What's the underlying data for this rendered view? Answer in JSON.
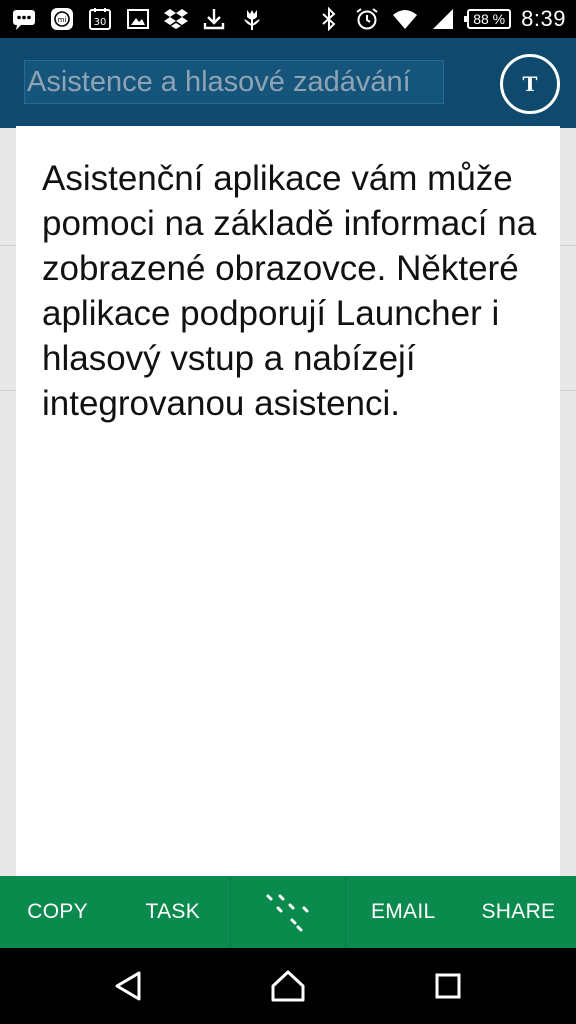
{
  "status_bar": {
    "left_icons": [
      "chat-bubble-icon",
      "mi-icon",
      "calendar-icon",
      "image-icon",
      "dropbox-icon",
      "download-icon",
      "tulip-icon"
    ],
    "calendar_day": "30",
    "battery": "88 %",
    "time": "8:39",
    "right_icons": [
      "bluetooth-icon",
      "alarm-icon",
      "wifi-icon",
      "signal-icon"
    ]
  },
  "app_bar": {
    "title": "Asistence a hlasové zadávání",
    "avatar_letter": "T"
  },
  "card": {
    "text": "Asistenční aplikace vám může pomoci na základě informací na zobrazené obrazovce. Některé aplikace podporují Launcher i hlasový vstup a nabízejí integrovanou asistenci."
  },
  "actions": {
    "copy": "COPY",
    "task": "TASK",
    "middle_icon": "dots-pattern-icon",
    "email": "EMAIL",
    "share": "SHARE"
  },
  "nav_bar": {
    "icons": [
      "back-icon",
      "home-icon",
      "recents-icon"
    ]
  },
  "colors": {
    "app_bar": "#0f4a6e",
    "action_bar": "#0b8a4e",
    "status_bar": "#000000"
  }
}
